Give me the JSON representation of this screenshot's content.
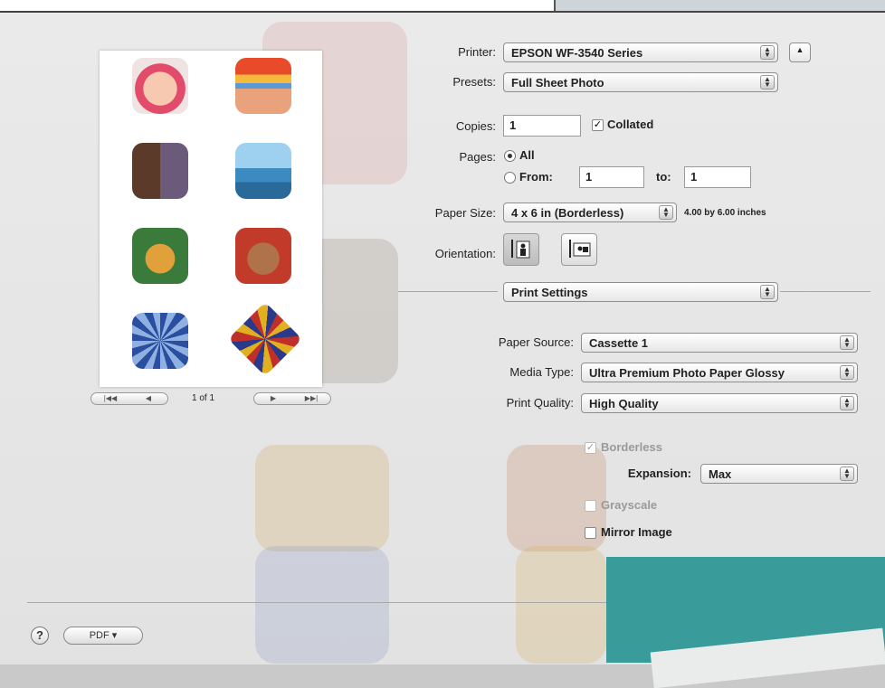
{
  "printer": {
    "label": "Printer:",
    "value": "EPSON WF-3540 Series"
  },
  "presets": {
    "label": "Presets:",
    "value": "Full Sheet Photo"
  },
  "copies": {
    "label": "Copies:",
    "value": "1",
    "collated_label": "Collated",
    "collated": true
  },
  "pages": {
    "label": "Pages:",
    "all_label": "All",
    "from_label": "From:",
    "from_value": "1",
    "to_label": "to:",
    "to_value": "1",
    "selected": "All"
  },
  "paper_size": {
    "label": "Paper Size:",
    "value": "4 x 6 in (Borderless)",
    "dimensions": "4.00 by 6.00 inches"
  },
  "orientation": {
    "label": "Orientation:",
    "selected": "portrait"
  },
  "section": {
    "value": "Print Settings"
  },
  "paper_source": {
    "label": "Paper Source:",
    "value": "Cassette 1"
  },
  "media_type": {
    "label": "Media Type:",
    "value": "Ultra Premium Photo Paper Glossy"
  },
  "print_quality": {
    "label": "Print Quality:",
    "value": "High Quality"
  },
  "borderless": {
    "label": "Borderless",
    "checked": true,
    "enabled": false
  },
  "expansion": {
    "label": "Expansion:",
    "value": "Max"
  },
  "grayscale": {
    "label": "Grayscale",
    "checked": false,
    "enabled": false
  },
  "mirror": {
    "label": "Mirror Image",
    "checked": false
  },
  "preview": {
    "page_indicator": "1 of 1"
  },
  "footer": {
    "help": "?",
    "pdf": "PDF ▾"
  },
  "colors": {
    "accent": "#3a9c9a",
    "dialog_bg": "#e6e6e6"
  }
}
